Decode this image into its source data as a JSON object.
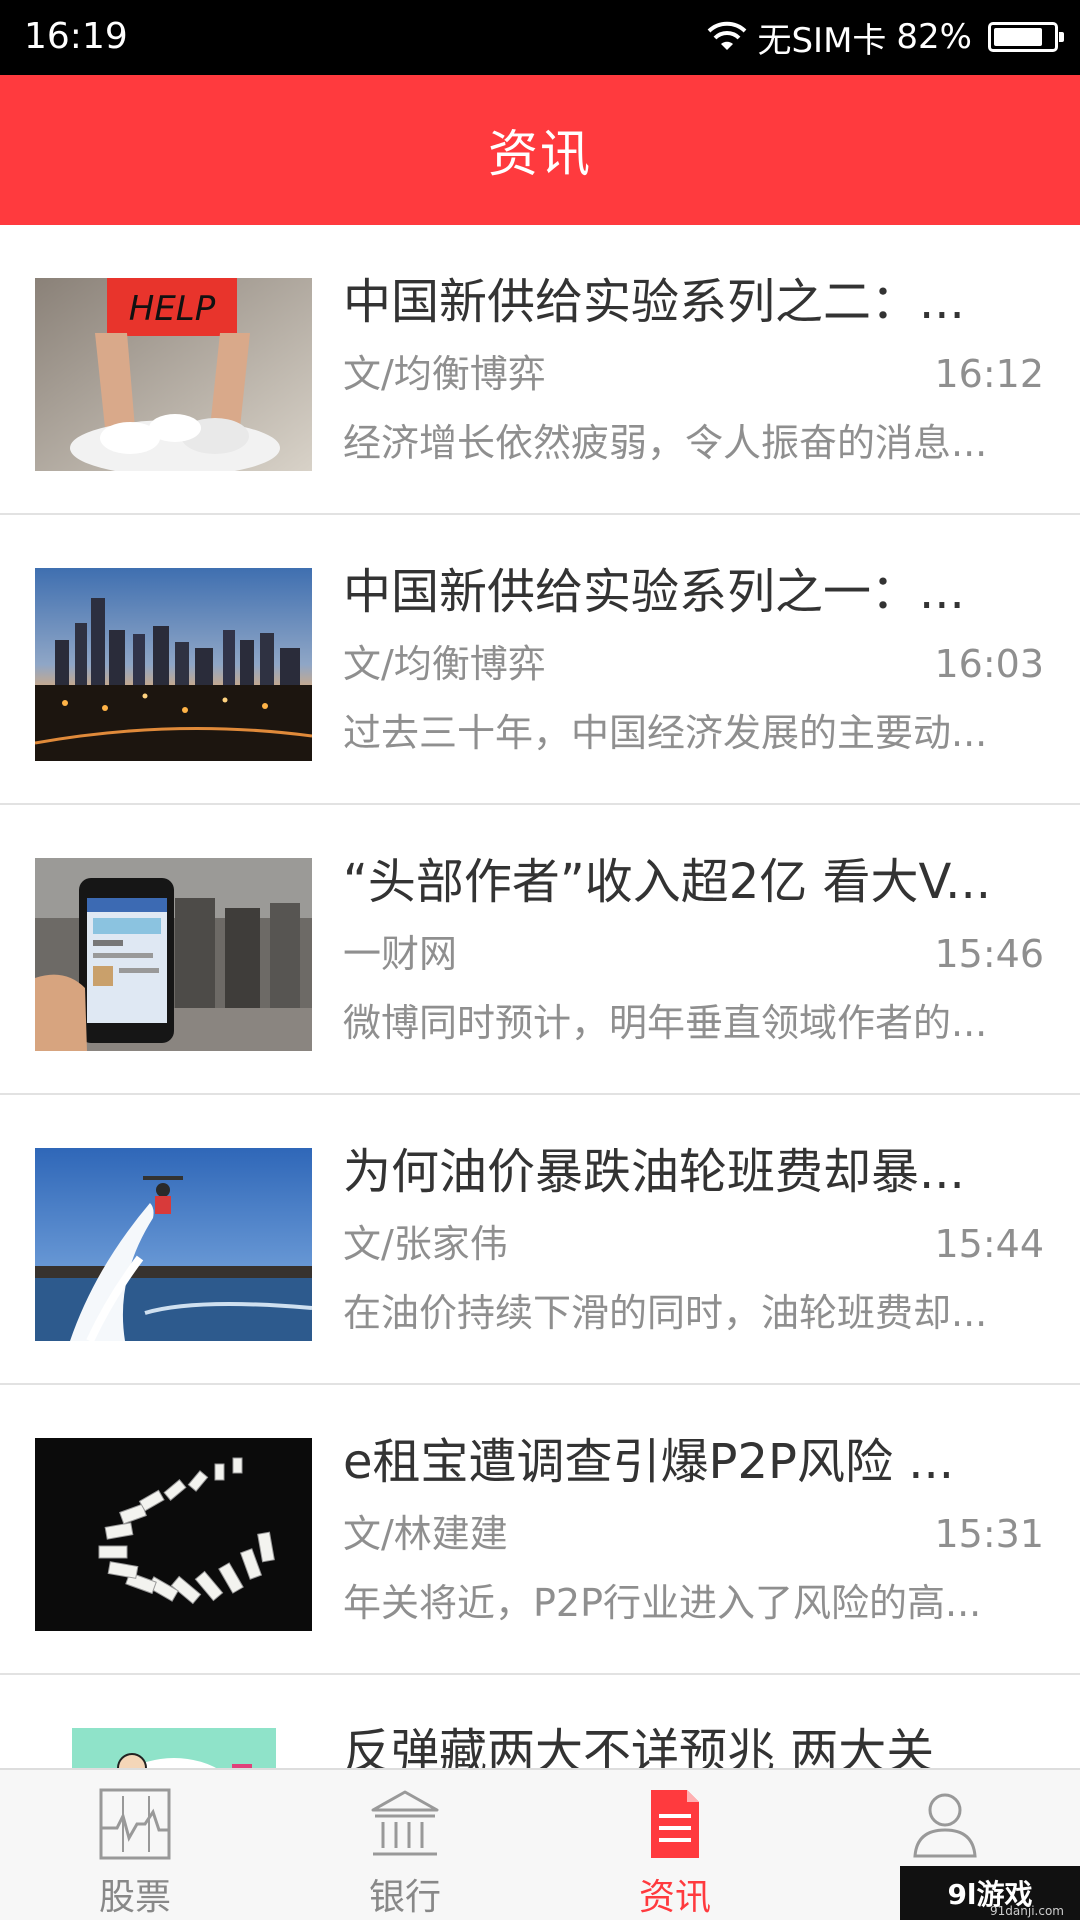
{
  "status_bar": {
    "time": "16:19",
    "carrier": "无SIM卡",
    "battery": "82%",
    "battery_level": 0.82
  },
  "header": {
    "title": "资讯"
  },
  "news": [
    {
      "title": "中国新供给实验系列之二：...",
      "source": "文/均衡博弈",
      "time": "16:12",
      "summary": "经济增长依然疲弱，令人振奋的消息...",
      "image": "help-sign-photo",
      "sign_text": "HELP"
    },
    {
      "title": "中国新供给实验系列之一：...",
      "source": "文/均衡博弈",
      "time": "16:03",
      "summary": "过去三十年，中国经济发展的主要动...",
      "image": "city-skyline-photo"
    },
    {
      "title": "“头部作者”收入超2亿 看大V...",
      "source": "一财网",
      "time": "15:46",
      "summary": "微博同时预计，明年垂直领域作者的...",
      "image": "phone-in-hand-photo"
    },
    {
      "title": "为何油价暴跌油轮班费却暴...",
      "source": "文/张家伟",
      "time": "15:44",
      "summary": "在油价持续下滑的同时，油轮班费却...",
      "image": "water-jetpack-photo"
    },
    {
      "title": "e租宝遭调查引爆P2P风险 ...",
      "source": "文/林建建",
      "time": "15:31",
      "summary": "年关将近，P2P行业进入了风险的高...",
      "image": "dominoes-photo"
    },
    {
      "title": "反弹藏两大不详预兆 两大关",
      "source": "",
      "time": "",
      "summary": "",
      "image": "cartoon-illustration"
    }
  ],
  "bottom_nav": [
    {
      "label": "股票",
      "icon": "stock-chart-icon",
      "active": false
    },
    {
      "label": "银行",
      "icon": "bank-icon",
      "active": false
    },
    {
      "label": "资讯",
      "icon": "news-document-icon",
      "active": true
    },
    {
      "label": "",
      "icon": "user-profile-icon",
      "active": false
    }
  ],
  "watermark": {
    "text": "9l游戏",
    "subtext": "91danji.com"
  },
  "colors": {
    "accent": "#ff3a3e",
    "text_primary": "#333333",
    "text_secondary": "#8f8f8f"
  }
}
